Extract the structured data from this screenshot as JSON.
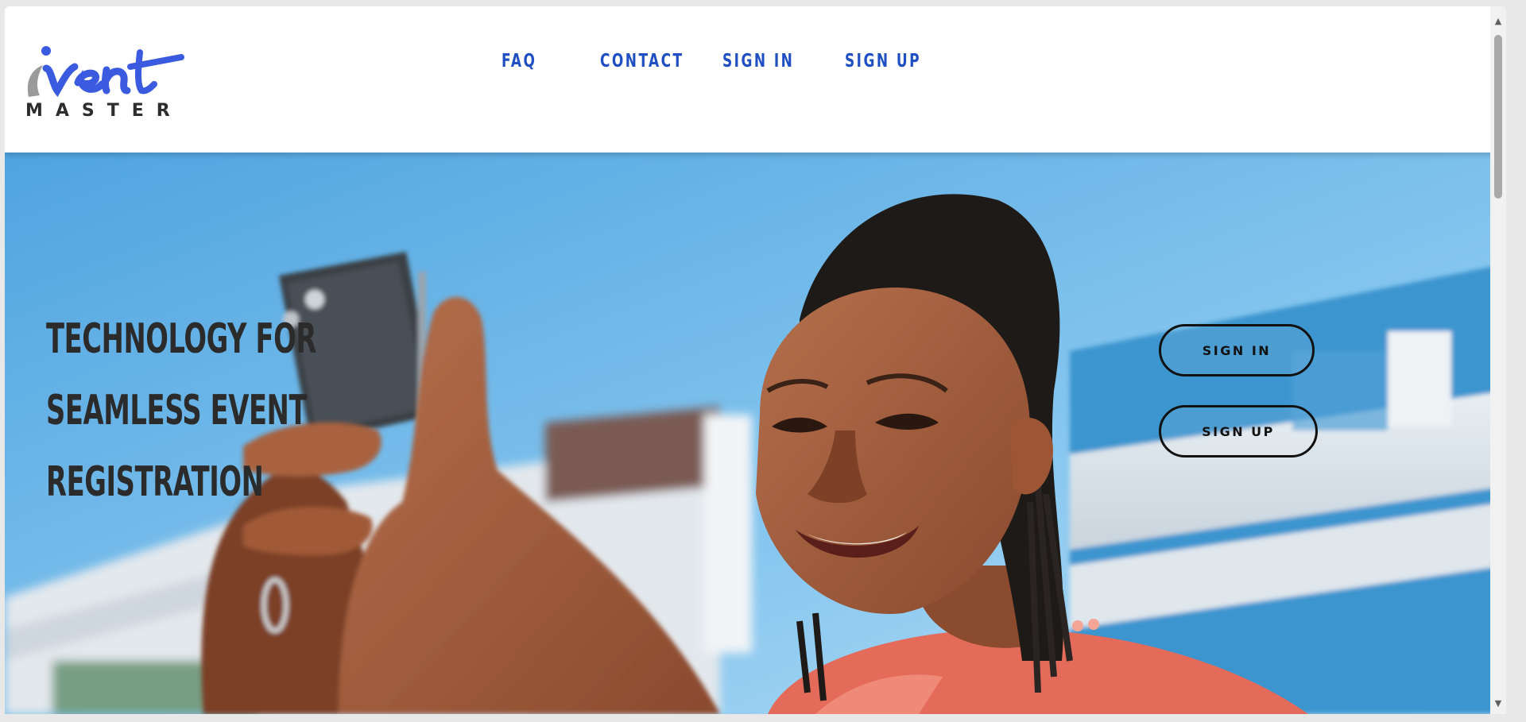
{
  "logo": {
    "script_text": "ivent",
    "subtext": "MASTER"
  },
  "nav": {
    "items": [
      {
        "label": "FAQ"
      },
      {
        "label": "CONTACT"
      },
      {
        "label": "SIGN IN"
      },
      {
        "label": "SIGN UP"
      }
    ]
  },
  "hero": {
    "headline_lines": [
      "TECHNOLOGY FOR",
      "SEAMLESS EVENT",
      "REGISTRATION"
    ],
    "sign_in_label": "SIGN IN",
    "sign_up_label": "SIGN UP"
  },
  "icons": {
    "scroll_up": "scroll-up-arrow-icon",
    "scroll_down": "scroll-down-arrow-icon"
  },
  "colors": {
    "nav_text": "#1f4fc2",
    "logo_blue": "#3a5be0",
    "headline_text": "#2b2b2b",
    "sky": "#7cc0ee"
  }
}
